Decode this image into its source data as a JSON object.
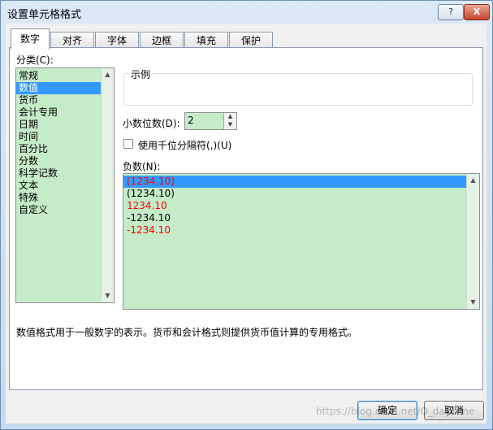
{
  "window": {
    "title": "设置单元格格式",
    "help_label": "?",
    "close_label": "X"
  },
  "tabs": [
    {
      "label": "数字"
    },
    {
      "label": "对齐"
    },
    {
      "label": "字体"
    },
    {
      "label": "边框"
    },
    {
      "label": "填充"
    },
    {
      "label": "保护"
    }
  ],
  "category": {
    "label": "分类(C):",
    "items": [
      "常规",
      "数值",
      "货币",
      "会计专用",
      "日期",
      "时间",
      "百分比",
      "分数",
      "科学记数",
      "文本",
      "特殊",
      "自定义"
    ],
    "selected_index": 1
  },
  "sample": {
    "label": "示例",
    "value": ""
  },
  "decimal": {
    "label": "小数位数(D):",
    "value": "2"
  },
  "thousands": {
    "label": "使用千位分隔符(,)(U)",
    "checked": false
  },
  "negative": {
    "label": "负数(N):",
    "items": [
      {
        "text": "(1234.10)",
        "color": "#ff0000"
      },
      {
        "text": "(1234.10)",
        "color": "#000000"
      },
      {
        "text": "1234.10",
        "color": "#ff0000"
      },
      {
        "text": "-1234.10",
        "color": "#000000"
      },
      {
        "text": "-1234.10",
        "color": "#ff0000"
      }
    ],
    "selected_index": 0
  },
  "description": "数值格式用于一般数字的表示。货币和会计格式则提供货币值计算的专用格式。",
  "buttons": {
    "ok": "确定",
    "cancel": "取消"
  },
  "watermark": "https://blog.csdn.net/O_dayTime",
  "colors": {
    "list_bg": "#c5ebc9",
    "selection": "#3399ff",
    "negative_red": "#ff0000"
  }
}
